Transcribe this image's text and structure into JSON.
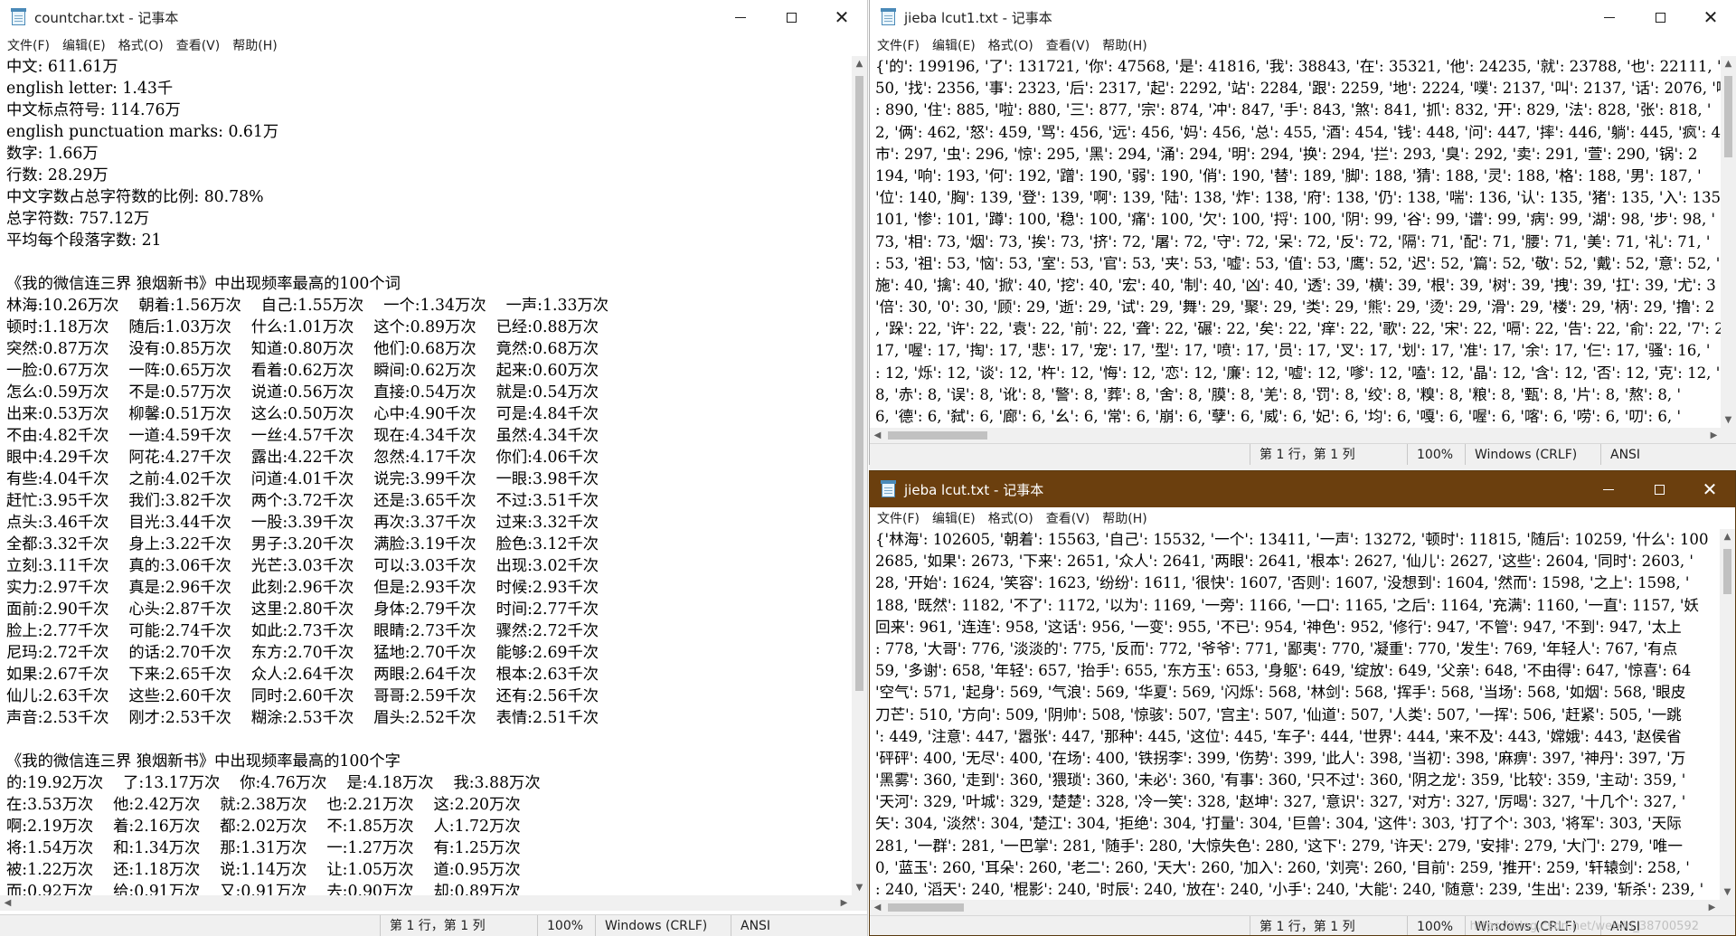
{
  "menu": [
    "文件(F)",
    "编辑(E)",
    "格式(O)",
    "查看(V)",
    "帮助(H)"
  ],
  "window_buttons": {
    "minimize": "minimize-icon",
    "maximize": "maximize-icon",
    "close": "close-icon"
  },
  "colors": {
    "active_titlebar": "#6b3f0e",
    "inactive_titlebar": "#ffffff",
    "statusbar": "#f0f0f0"
  },
  "windows": {
    "left": {
      "title": "countchar.txt - 记事本",
      "lines": [
        "中文: 611.61万",
        "english letter: 1.43千",
        "中文标点符号: 114.76万",
        "english punctuation marks: 0.61万",
        "数字: 1.66万",
        "行数: 28.29万",
        "中文字数占总字符数的比例: 80.78%",
        "总字符数: 757.12万",
        "平均每个段落字数: 21",
        "",
        "《我的微信连三界 狼烟新书》中出现频率最高的100个词",
        "林海:10.26万次    朝着:1.56万次    自己:1.55万次    一个:1.34万次    一声:1.33万次",
        "顿时:1.18万次    随后:1.03万次    什么:1.01万次    这个:0.89万次    已经:0.88万次",
        "突然:0.87万次    没有:0.85万次    知道:0.80万次    他们:0.68万次    竟然:0.68万次",
        "一脸:0.67万次    一阵:0.65万次    看着:0.62万次    瞬间:0.62万次    起来:0.60万次",
        "怎么:0.59万次    不是:0.57万次    说道:0.56万次    直接:0.54万次    就是:0.54万次",
        "出来:0.53万次    柳馨:0.51万次    这么:0.50万次    心中:4.90千次    可是:4.84千次",
        "不由:4.82千次    一道:4.59千次    一丝:4.57千次    现在:4.34千次    虽然:4.34千次",
        "眼中:4.29千次    阿花:4.27千次    露出:4.22千次    忽然:4.17千次    你们:4.06千次",
        "有些:4.04千次    之前:4.02千次    问道:4.01千次    说完:3.99千次    一眼:3.98千次",
        "赶忙:3.95千次    我们:3.82千次    两个:3.72千次    还是:3.65千次    不过:3.51千次",
        "点头:3.46千次    目光:3.44千次    一股:3.39千次    再次:3.37千次    过来:3.32千次",
        "全都:3.32千次    身上:3.22千次    男子:3.20千次    满脸:3.19千次    脸色:3.12千次",
        "立刻:3.11千次    真的:3.06千次    光芒:3.03千次    可以:3.03千次    出现:3.02千次",
        "实力:2.97千次    真是:2.96千次    此刻:2.96千次    但是:2.93千次    时候:2.93千次",
        "面前:2.90千次    心头:2.87千次    这里:2.80千次    身体:2.79千次    时间:2.77千次",
        "脸上:2.77千次    可能:2.74千次    如此:2.73千次    眼睛:2.73千次    骤然:2.72千次",
        "尼玛:2.72千次    的话:2.70千次    东方:2.70千次    猛地:2.70千次    能够:2.69千次",
        "如果:2.67千次    下来:2.65千次    众人:2.64千次    两眼:2.64千次    根本:2.63千次",
        "仙儿:2.63千次    这些:2.60千次    同时:2.60千次    哥哥:2.59千次    还有:2.56千次",
        "声音:2.53千次    刚才:2.53千次    糊涂:2.53千次    眉头:2.52千次    表情:2.51千次",
        "",
        "《我的微信连三界 狼烟新书》中出现频率最高的100个字",
        "的:19.92万次    了:13.17万次    你:4.76万次    是:4.18万次    我:3.88万次",
        "在:3.53万次    他:2.42万次    就:2.38万次    也:2.21万次    这:2.20万次",
        "啊:2.19万次    着:2.16万次    都:2.02万次    不:1.85万次    人:1.72万次",
        "将:1.54万次    和:1.34万次    那:1.31万次    一:1.27万次    有:1.25万次",
        "被:1.22万次    还:1.18万次    说:1.14万次    让:1.05万次    道:0.95万次",
        "而:0.92万次    给:0.91万次    又:0.91万次    去:0.90万次    却:0.89万次"
      ],
      "status": {
        "position": "第 1 行，第 1 列",
        "zoom": "100%",
        "eol": "Windows (CRLF)",
        "encoding": "ANSI"
      }
    },
    "right_top": {
      "title": "jieba lcut1.txt - 记事本",
      "lines": [
        "{'的': 199196, '了': 131721, '你': 47568, '是': 41816, '我': 38843, '在': 35321, '他': 24235, '就': 23788, '也': 22111, '这",
        "50, '找': 2356, '事': 2323, '后': 2317, '起': 2292, '站': 2284, '跟': 2259, '地': 2224, '噗': 2137, '叫': 2137, '话': 2076, '啊",
        ": 890, '住': 885, '啦': 880, '三': 877, '宗': 874, '冲': 847, '手': 843, '煞': 841, '抓': 832, '开': 829, '法': 828, '张': 818, '",
        "2, '俩': 462, '怒': 459, '骂': 456, '远': 456, '妈': 456, '总': 455, '酒': 454, '钱': 448, '问': 447, '摔': 446, '躺': 445, '疯': 4",
        "市': 297, '虫': 296, '惊': 295, '黑': 294, '涌': 294, '明': 294, '换': 294, '拦': 293, '臭': 292, '卖': 291, '萱': 290, '锅': 2",
        "194, '响': 193, '何': 192, '蹭': 190, '弱': 190, '俏': 190, '替': 189, '脚': 188, '猜': 188, '灵': 188, '格': 188, '男': 187, '",
        "'位': 140, '胸': 139, '登': 139, '啊': 139, '陆': 138, '炸': 138, '府': 138, '仍': 138, '喘': 136, '认': 135, '猪': 135, '入': 135",
        "101, '惨': 101, '蹲': 100, '稳': 100, '痛': 100, '欠': 100, '捋': 100, '阴': 99, '谷': 99, '谱': 99, '病': 99, '湖': 98, '步': 98, '",
        "73, '相': 73, '烟': 73, '挨': 73, '挤': 72, '屠': 72, '守': 72, '呆': 72, '反': 72, '隔': 71, '配': 71, '腰': 71, '美': 71, '礼': 71, '",
        ": 53, '祖': 53, '恼': 53, '室': 53, '官': 53, '夹': 53, '嘘': 53, '值': 53, '鹰': 52, '迟': 52, '篇': 52, '敬': 52, '戴': 52, '意': 52, '",
        "施': 40, '擒': 40, '掀': 40, '挖': 40, '宏': 40, '制': 40, '凶': 40, '透': 39, '横': 39, '根': 39, '树': 39, '拽': 39, '扛': 39, '尤': 3",
        "'倍': 30, '0': 30, '顾': 29, '逝': 29, '试': 29, '舞': 29, '聚': 29, '类': 29, '熊': 29, '烫': 29, '滑': 29, '楼': 29, '柄': 29, '撸': 2",
        ", '跺': 22, '许': 22, '袁': 22, '前': 22, '聋': 22, '碾': 22, '矣': 22, '痒': 22, '歌': 22, '宋': 22, '嗝': 22, '告': 22, '俞': 22, '7': 2",
        "17, '喔': 17, '掏': 17, '悲': 17, '宠': 17, '型': 17, '喷': 17, '员': 17, '叉': 17, '划': 17, '准': 17, '余': 17, '仨': 17, '骚': 16, '",
        ": 12, '烁': 12, '谈': 12, '杵': 12, '悔': 12, '恋': 12, '廉': 12, '嘘': 12, '嗲': 12, '嗑': 12, '晶': 12, '含': 12, '否': 12, '克': 12, '",
        "8, '赤': 8, '误': 8, '讹': 8, '警': 8, '葬': 8, '舍': 8, '膜': 8, '羌': 8, '罚': 8, '绞': 8, '糗': 8, '粮': 8, '甄': 8, '片': 8, '熬': 8, '",
        "6, '德': 6, '弑': 6, '廊': 6, '幺': 6, '常': 6, '崩': 6, '孽': 6, '威': 6, '妃': 6, '均': 6, '嘎': 6, '喔': 6, '喀': 6, '唠': 6, '叨': 6, '"
      ],
      "status": {
        "position": "第 1 行，第 1 列",
        "zoom": "100%",
        "eol": "Windows (CRLF)",
        "encoding": "ANSI"
      }
    },
    "right_bottom": {
      "title": "jieba lcut.txt - 记事本",
      "lines": [
        "{'林海': 102605, '朝着': 15563, '自己': 15532, '一个': 13411, '一声': 13272, '顿时': 11815, '随后': 10259, '什么': 100",
        "2685, '如果': 2673, '下来': 2651, '众人': 2641, '两眼': 2641, '根本': 2627, '仙儿': 2627, '这些': 2604, '同时': 2603, '",
        "28, '开始': 1624, '笑容': 1623, '纷纷': 1611, '很快': 1607, '否则': 1607, '没想到': 1604, '然而': 1598, '之上': 1598, '",
        "188, '既然': 1182, '不了': 1172, '以为': 1169, '一旁': 1166, '一口': 1165, '之后': 1164, '充满': 1160, '一直': 1157, '妖",
        "回来': 961, '连连': 958, '这话': 956, '一变': 955, '不已': 954, '神色': 952, '修行': 947, '不管': 947, '不到': 947, '太上",
        ": 778, '大哥': 776, '淡淡的': 775, '反而': 772, '爷爷': 771, '鄙夷': 770, '凝重': 770, '发生': 769, '年轻人': 767, '有点",
        "59, '多谢': 658, '年轻': 657, '抬手': 655, '东方玉': 653, '身躯': 649, '绽放': 649, '父亲': 648, '不由得': 647, '惊喜': 64",
        "'空气': 571, '起身': 569, '气浪': 569, '华夏': 569, '闪烁': 568, '林剑': 568, '挥手': 568, '当场': 568, '如烟': 568, '眼皮",
        "刀芒': 510, '方向': 509, '阴帅': 508, '惊骇': 507, '宫主': 507, '仙道': 507, '人类': 507, '一挥': 506, '赶紧': 505, '一跳",
        "': 449, '注意': 447, '嚣张': 447, '那种': 445, '这位': 445, '车子': 444, '世界': 444, '来不及': 443, '嫦娥': 443, '赵侯省",
        "'砰砰': 400, '无尽': 400, '在场': 400, '铁拐李': 399, '伤势': 399, '此人': 398, '当初': 398, '麻痹': 397, '神丹': 397, '万",
        "'黑雾': 360, '走到': 360, '猥琐': 360, '未必': 360, '有事': 360, '只不过': 360, '阴之龙': 359, '比较': 359, '主动': 359, '",
        "'天河': 329, '叶城': 329, '楚楚': 328, '冷一笑': 328, '赵坤': 327, '意识': 327, '对方': 327, '厉喝': 327, '十几个': 327, '",
        "矢': 304, '淡然': 304, '楚江': 304, '拒绝': 304, '打量': 304, '巨兽': 304, '这件': 303, '打了个': 303, '将军': 303, '天际",
        "281, '一群': 281, '一巴掌': 281, '随手': 280, '大惊失色': 280, '这下': 279, '许天': 279, '安排': 279, '大门': 279, '唯一",
        "0, '蓝玉': 260, '耳朵': 260, '老二': 260, '天大': 260, '加入': 260, '刘亮': 260, '目前': 259, '推开': 259, '轩辕剑': 258, '",
        ": 240, '滔天': 240, '棍影': 240, '时辰': 240, '放在': 240, '小手': 240, '大能': 240, '随意': 239, '生出': 239, '斩杀': 239, '"
      ],
      "status": {
        "position": "第 1 行，第 1 列",
        "zoom": "100%",
        "eol": "Windows (CRLF)",
        "encoding": "ANSI"
      }
    }
  },
  "watermark": "https://blog.csdn.net/weixin_38700592"
}
